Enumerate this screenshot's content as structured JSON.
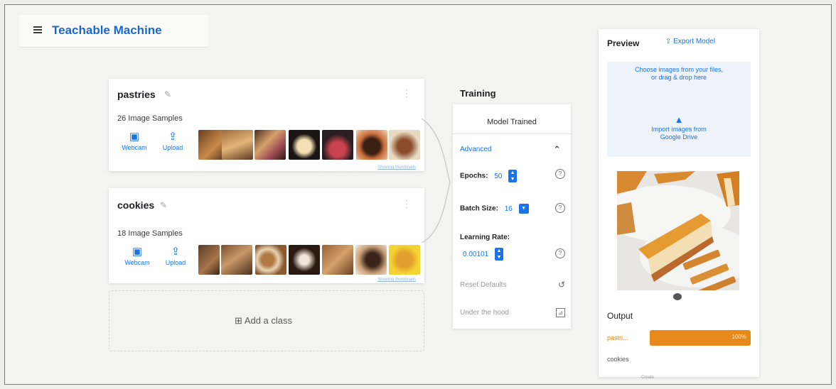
{
  "app": {
    "title": "Teachable Machine"
  },
  "classes": [
    {
      "name": "pastries",
      "count": "26 Image Samples",
      "webcam": "Webcam",
      "upload": "Upload",
      "thumb_caption": "Showing thumbnails"
    },
    {
      "name": "cookies",
      "count": "18 Image Samples",
      "webcam": "Webcam",
      "upload": "Upload",
      "thumb_caption": "Showing thumbnails"
    }
  ],
  "add_class": {
    "label": "Add a class"
  },
  "training": {
    "title": "Training",
    "status_button": "Model Trained",
    "advanced_label": "Advanced",
    "epochs_label": "Epochs:",
    "epochs_value": "50",
    "batch_label": "Batch Size:",
    "batch_value": "16",
    "lr_label": "Learning Rate:",
    "lr_value": "0.00101",
    "reset_label": "Reset Defaults",
    "hood_label": "Under the hood"
  },
  "preview": {
    "title": "Preview",
    "export_label": "Export Model",
    "file_drop_line1": "Choose images from your files,",
    "file_drop_line2": "or drag & drop here",
    "drive_line1": "Import images from",
    "drive_line2": "Google Drive",
    "output_label": "Output",
    "outputs": [
      {
        "label": "pastri...",
        "value": "100%",
        "fraction": 1.0
      },
      {
        "label": "cookies",
        "value": "",
        "fraction": 0.0
      }
    ],
    "footer_text": "Create"
  },
  "colors": {
    "accent": "#1a73e8",
    "output_bar": "#e8891c",
    "output_label": "#e8891c"
  },
  "icons": {
    "menu": "menu-icon",
    "webcam": "videocam-icon",
    "upload": "upload-icon",
    "add": "add-box-icon",
    "export": "export-icon",
    "drive": "drive-icon"
  }
}
